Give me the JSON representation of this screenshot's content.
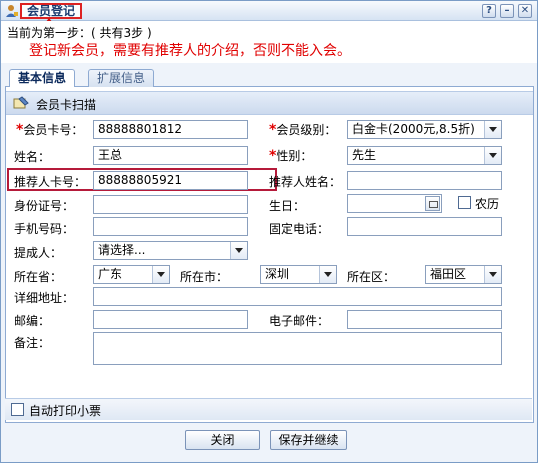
{
  "window": {
    "title": "会员登记",
    "buttons": {
      "help": "?",
      "minimize": "–",
      "close": "✕"
    }
  },
  "info": {
    "step": "当前为第一步：( 共有3步 )",
    "warning": "登记新会员，需要有推荐人的介绍，否则不能入会。"
  },
  "tabs": [
    {
      "label": "基本信息"
    },
    {
      "label": "扩展信息"
    }
  ],
  "scan": {
    "label": "会员卡扫描"
  },
  "form": {
    "card_no": {
      "label": "会员卡号：",
      "value": "88888801812"
    },
    "level": {
      "label": "会员级别：",
      "value": "白金卡(2000元,8.5折)"
    },
    "name": {
      "label": "姓名：",
      "value": "王总"
    },
    "gender": {
      "label": "性别：",
      "value": "先生"
    },
    "referrer_card": {
      "label": "推荐人卡号：",
      "value": "88888805921"
    },
    "referrer_name": {
      "label": "推荐人姓名：",
      "value": ""
    },
    "id_no": {
      "label": "身份证号：",
      "value": ""
    },
    "birthday": {
      "label": "生日：",
      "value": ""
    },
    "lunar": {
      "label": "农历"
    },
    "mobile": {
      "label": "手机号码：",
      "value": ""
    },
    "phone": {
      "label": "固定电话：",
      "value": ""
    },
    "proposer": {
      "label": "提成人：",
      "value": "请选择..."
    },
    "province": {
      "label": "所在省：",
      "value": "广东"
    },
    "city": {
      "label": "所在市：",
      "value": "深圳"
    },
    "district": {
      "label": "所在区：",
      "value": "福田区"
    },
    "address": {
      "label": "详细地址：",
      "value": ""
    },
    "zip": {
      "label": "邮编：",
      "value": ""
    },
    "email": {
      "label": "电子邮件：",
      "value": ""
    },
    "remark": {
      "label": "备注：",
      "value": ""
    }
  },
  "auto_print": {
    "label": "自动打印小票"
  },
  "actions": {
    "close": "关闭",
    "save_continue": "保存并继续"
  },
  "colors": {
    "accent_red": "#e00000",
    "border_blue": "#8eaad2",
    "highlight_box": "#b51a3a"
  }
}
